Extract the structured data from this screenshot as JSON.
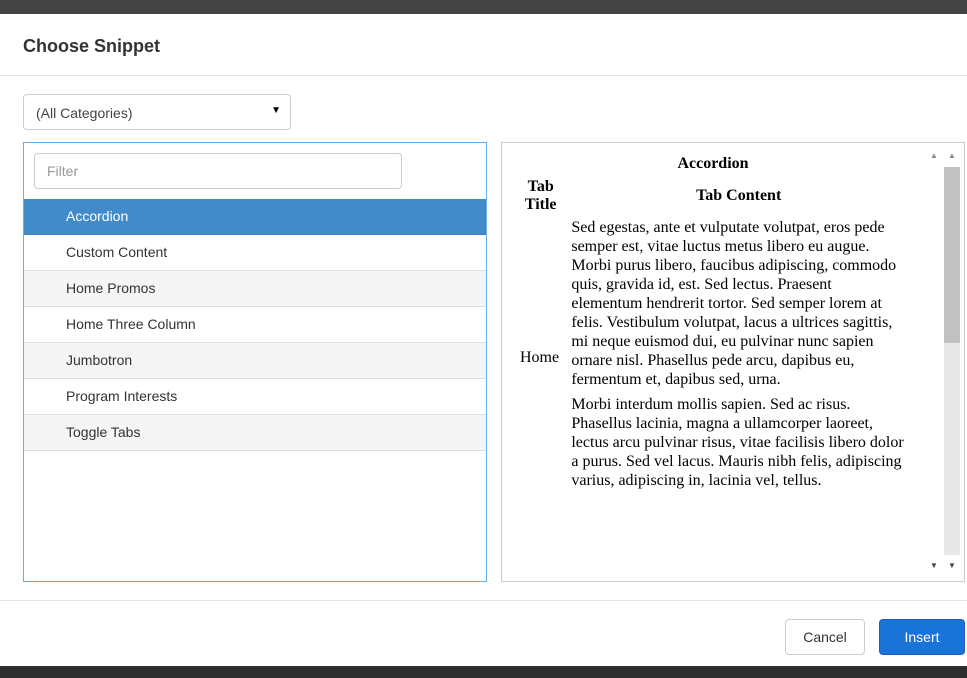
{
  "dialog": {
    "title": "Choose Snippet"
  },
  "category_select": {
    "value": "(All Categories)",
    "caret": "▼"
  },
  "filter": {
    "placeholder": "Filter",
    "value": ""
  },
  "snippets": [
    {
      "label": "Accordion",
      "selected": true
    },
    {
      "label": "Custom Content",
      "selected": false
    },
    {
      "label": "Home Promos",
      "selected": false
    },
    {
      "label": "Home Three Column",
      "selected": false
    },
    {
      "label": "Jumbotron",
      "selected": false
    },
    {
      "label": "Program Interests",
      "selected": false
    },
    {
      "label": "Toggle Tabs",
      "selected": false
    }
  ],
  "preview": {
    "caption": "Accordion",
    "headers": [
      "Tab Title",
      "Tab Content"
    ],
    "row_title": "Home",
    "paragraphs": [
      "Sed egestas, ante et vulputate volutpat, eros pede semper est, vitae luctus metus libero eu augue. Morbi purus libero, faucibus adipiscing, commodo quis, gravida id, est. Sed lectus. Praesent elementum hendrerit tortor. Sed semper lorem at felis. Vestibulum volutpat, lacus a ultrices sagittis, mi neque euismod dui, eu pulvinar nunc sapien ornare nisl. Phasellus pede arcu, dapibus eu, fermentum et, dapibus sed, urna.",
      "Morbi interdum mollis sapien. Sed ac risus. Phasellus lacinia, magna a ullamcorper laoreet, lectus arcu pulvinar risus, vitae facilisis libero dolor a purus. Sed vel lacus. Mauris nibh felis, adipiscing varius, adipiscing in, lacinia vel, tellus."
    ]
  },
  "scrollbar": {
    "up_arrow": "▲",
    "down_arrow": "▼"
  },
  "footer": {
    "cancel_label": "Cancel",
    "insert_label": "Insert"
  },
  "colors": {
    "accent": "#428bca",
    "primary_button": "#1a73d9"
  }
}
